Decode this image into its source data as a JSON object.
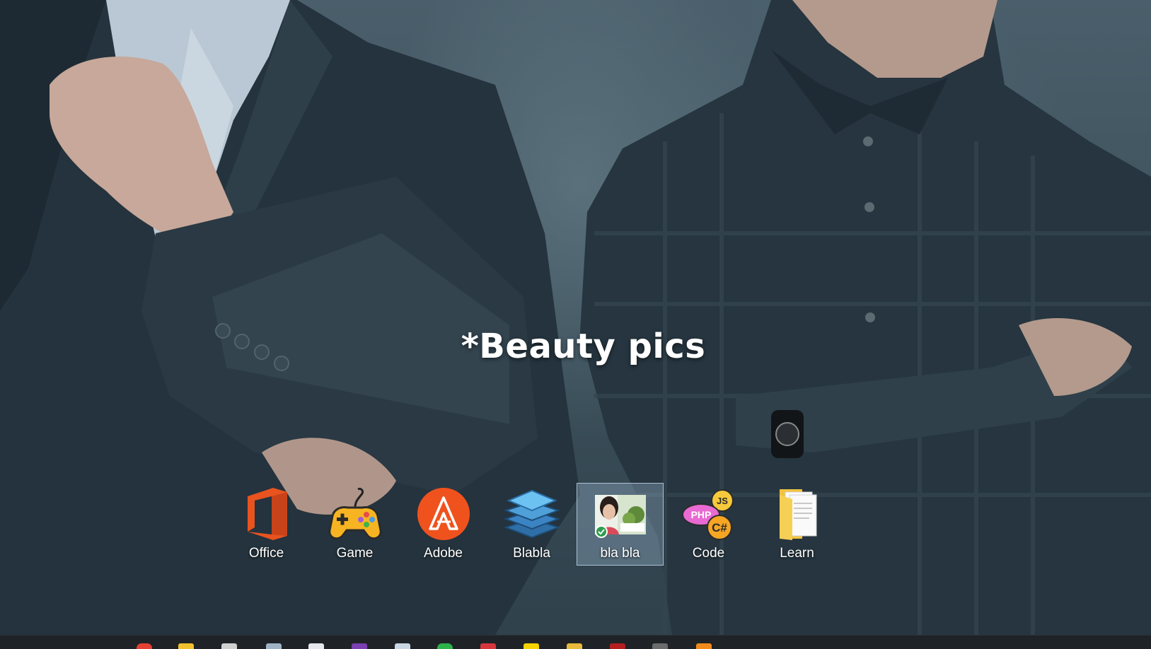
{
  "desktop": {
    "caption": "*Beauty pics",
    "icons": [
      {
        "label": "Office",
        "icon": "office-icon",
        "selected": false
      },
      {
        "label": "Game",
        "icon": "gamepad-icon",
        "selected": false
      },
      {
        "label": "Adobe",
        "icon": "adobe-icon",
        "selected": false
      },
      {
        "label": "Blabla",
        "icon": "layers-icon",
        "selected": false
      },
      {
        "label": "bla bla",
        "icon": "photo-folder-icon",
        "selected": true
      },
      {
        "label": "Code",
        "icon": "code-icon",
        "selected": false
      },
      {
        "label": "Learn",
        "icon": "folder-icon",
        "selected": false
      }
    ],
    "code_badges": [
      "JS",
      "PHP",
      "C#"
    ]
  },
  "taskbar": {
    "icons": [
      "chrome-icon",
      "file-explorer-icon",
      "paint-icon",
      "notepad-icon",
      "calendar-icon",
      "premiere-icon",
      "box-icon",
      "spotify-icon",
      "red-app-icon",
      "sticky-notes-icon",
      "folder-icon",
      "acrobat-icon",
      "photo-icon",
      "vlc-icon"
    ]
  },
  "colors": {
    "office": "#e8531f",
    "adobe": "#f0521e",
    "blabla": "#4f9fd8",
    "taskbar": "#1f2327",
    "selection": "#a0bed7"
  }
}
